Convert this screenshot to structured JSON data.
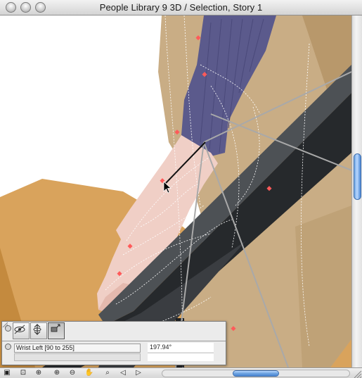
{
  "window": {
    "title": "People Library 9 3D / Selection, Story 1"
  },
  "colors": {
    "floor": "#d9a35c",
    "floor_dark": "#c48a3e",
    "body_tan": "#c9ad85",
    "sleeve": "#5b5a8c",
    "skin": "#f0cfc6",
    "railing_top": "#4d5155",
    "railing_side": "#26292c",
    "hotspot": "#ff5a5a",
    "scroll_thumb": "#6da3e0"
  },
  "viewport": {
    "cursor_icon": "arrow-cursor-icon"
  },
  "palette": {
    "tools": [
      {
        "name": "orbit-tool-icon",
        "glyph": "⊛"
      },
      {
        "name": "rotate-tool-icon",
        "glyph": "⟲"
      },
      {
        "name": "move-tool-icon",
        "glyph": "⤡"
      }
    ],
    "parameter_label": "Wrist Left [90 to 255]",
    "parameter_value": "197.94°"
  },
  "bottombar": {
    "tools": [
      {
        "name": "3d-view-icon",
        "glyph": "▣"
      },
      {
        "name": "fit-window-icon",
        "glyph": "⊡"
      },
      {
        "name": "zoom-toggle-icon",
        "glyph": "⊕"
      },
      {
        "name": "zoom-in-icon",
        "glyph": "⊕"
      },
      {
        "name": "zoom-out-icon",
        "glyph": "⊖"
      },
      {
        "name": "pan-hand-icon",
        "glyph": "✋"
      },
      {
        "name": "zoom-area-icon",
        "glyph": "⌕"
      },
      {
        "name": "zoom-previous-icon",
        "glyph": "◁"
      },
      {
        "name": "zoom-next-icon",
        "glyph": "▷"
      }
    ]
  }
}
